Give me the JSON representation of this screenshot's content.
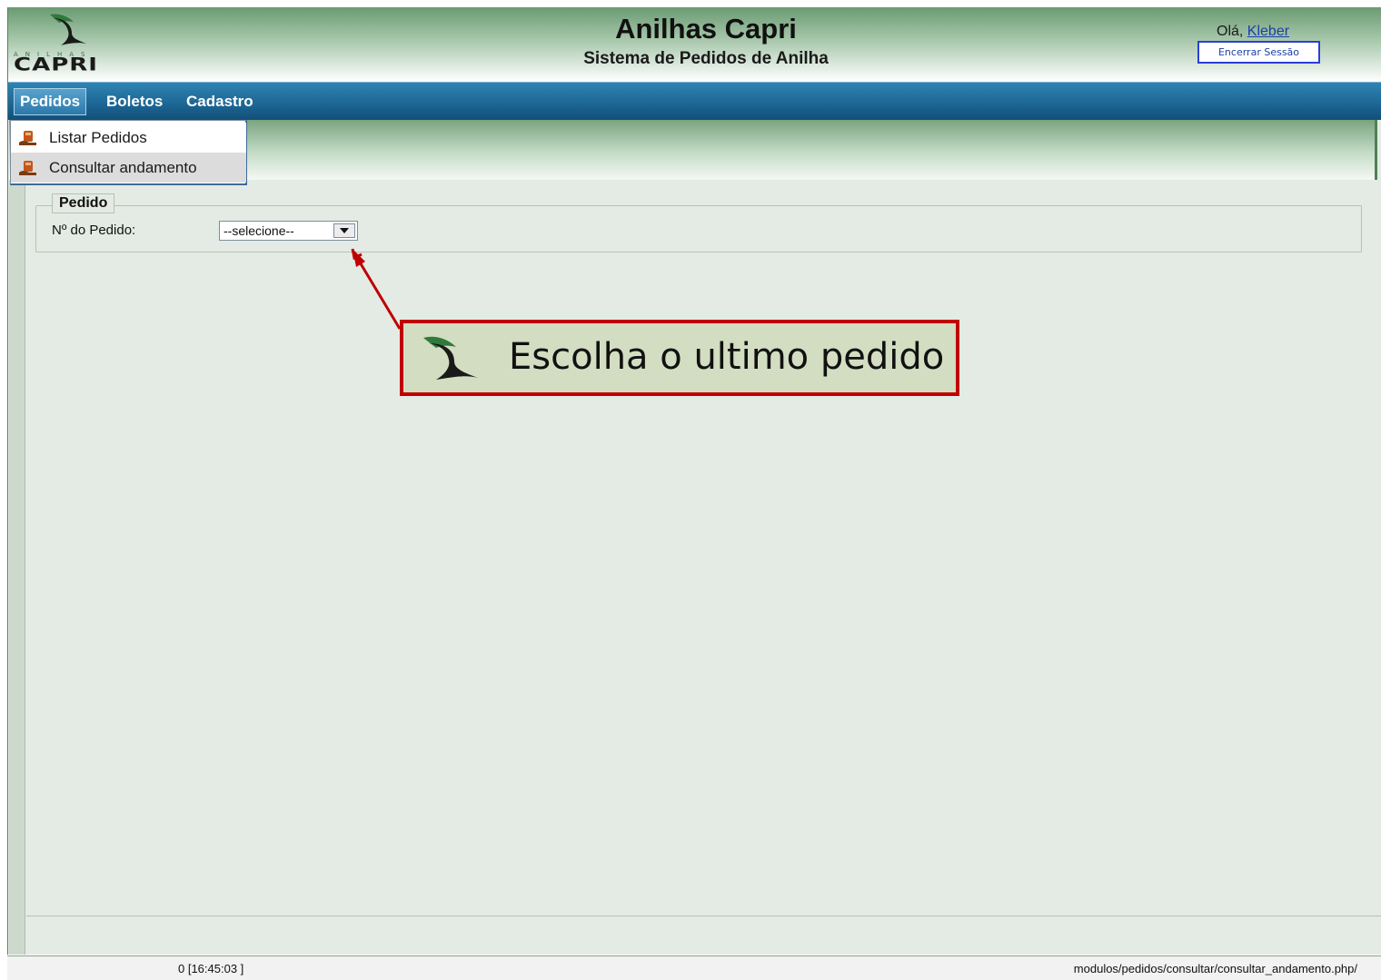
{
  "header": {
    "logo_subtext": "ANILHAS",
    "logo_text": "CAPRI",
    "title": "Anilhas Capri",
    "subtitle": "Sistema de Pedidos de Anilha",
    "greeting_prefix": "Olá, ",
    "user_name": "Kleber",
    "logout_label": "Encerrar Sessão"
  },
  "menu": {
    "items": [
      {
        "label": "Pedidos",
        "active": true
      },
      {
        "label": "Boletos",
        "active": false
      },
      {
        "label": "Cadastro",
        "active": false
      }
    ],
    "dropdown": [
      {
        "label": "Listar Pedidos",
        "icon": "order-icon"
      },
      {
        "label": "Consultar andamento",
        "icon": "order-icon",
        "highlighted": true
      }
    ]
  },
  "form": {
    "legend": "Pedido",
    "order_number_label": "Nº do Pedido:",
    "order_select_value": "--selecione--"
  },
  "status_bar": {
    "time": "0 [16:45:03 ]",
    "path": "modulos/pedidos/consultar/consultar_andamento.php/"
  },
  "annotation": {
    "text": "Escolha o ultimo pedido",
    "border_color": "#c00000",
    "background": "#d3ddc1"
  },
  "colors": {
    "menu_blue": "#1c6593",
    "brand_green": "#2f7a3c",
    "content_bg": "#e4ebe4"
  }
}
